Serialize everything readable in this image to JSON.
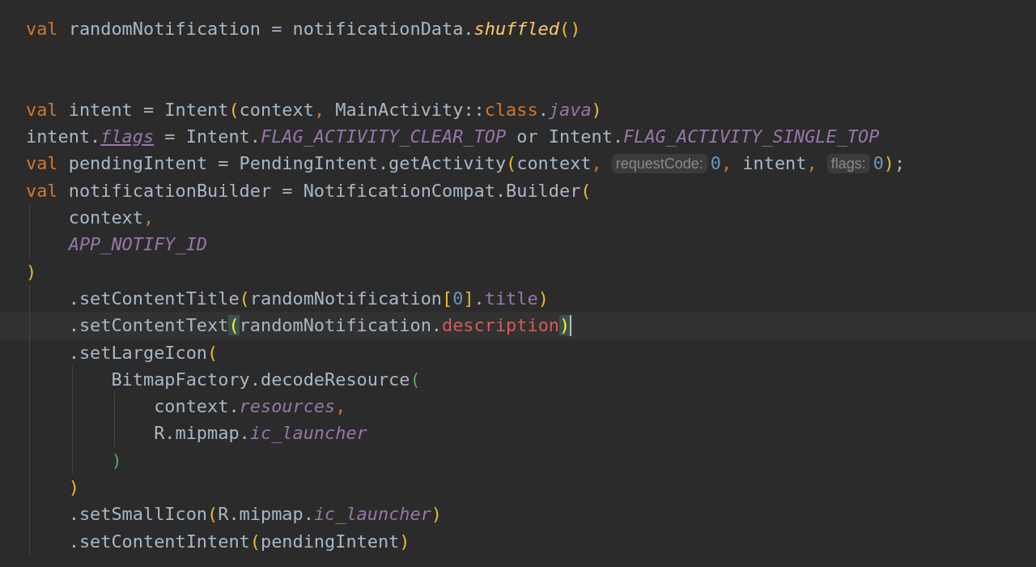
{
  "editor": {
    "lines": [
      {
        "current": false,
        "tokens": [
          {
            "kind": "kw",
            "text": "val"
          },
          {
            "kind": "plain",
            "text": " randomNotification = notificationData."
          },
          {
            "kind": "fn",
            "text": "shuffled"
          },
          {
            "kind": "paren",
            "text": "()"
          }
        ]
      },
      {
        "current": false
      },
      {
        "current": false
      },
      {
        "current": false,
        "tokens": [
          {
            "kind": "kw",
            "text": "val"
          },
          {
            "kind": "plain",
            "text": " intent = Intent"
          },
          {
            "kind": "paren",
            "text": "("
          },
          {
            "kind": "plain",
            "text": "context"
          },
          {
            "kind": "punct",
            "text": ","
          },
          {
            "kind": "plain",
            "text": " MainActivity::"
          },
          {
            "kind": "kw",
            "text": "class"
          },
          {
            "kind": "plain",
            "text": "."
          },
          {
            "kind": "ital",
            "text": "java"
          },
          {
            "kind": "paren",
            "text": ")"
          }
        ]
      },
      {
        "current": false,
        "tokens": [
          {
            "kind": "plain",
            "text": "intent."
          },
          {
            "kind": "underlined",
            "text": "flags"
          },
          {
            "kind": "plain",
            "text": " = Intent."
          },
          {
            "kind": "ital",
            "text": "FLAG_ACTIVITY_CLEAR_TOP"
          },
          {
            "kind": "plain",
            "text": " or Intent."
          },
          {
            "kind": "ital",
            "text": "FLAG_ACTIVITY_SINGLE_TOP"
          }
        ]
      },
      {
        "current": false,
        "tokens": [
          {
            "kind": "kw",
            "text": "val"
          },
          {
            "kind": "plain",
            "text": " pendingIntent = PendingIntent.getActivity"
          },
          {
            "kind": "paren",
            "text": "("
          },
          {
            "kind": "plain",
            "text": "context"
          },
          {
            "kind": "punct",
            "text": ","
          },
          {
            "kind": "hint",
            "text": "requestCode:"
          },
          {
            "kind": "num",
            "text": "0"
          },
          {
            "kind": "punct",
            "text": ","
          },
          {
            "kind": "plain",
            "text": " intent"
          },
          {
            "kind": "punct",
            "text": ","
          },
          {
            "kind": "hint",
            "text": "flags:"
          },
          {
            "kind": "num",
            "text": "0"
          },
          {
            "kind": "paren",
            "text": ")"
          },
          {
            "kind": "plain",
            "text": ";"
          }
        ]
      },
      {
        "current": false,
        "tokens": [
          {
            "kind": "kw",
            "text": "val"
          },
          {
            "kind": "plain",
            "text": " notificationBuilder = NotificationCompat.Builder"
          },
          {
            "kind": "paren",
            "text": "("
          }
        ]
      },
      {
        "current": false,
        "tokens": [
          {
            "kind": "plain",
            "text": "    context"
          },
          {
            "kind": "punct",
            "text": ","
          }
        ]
      },
      {
        "current": false,
        "tokens": [
          {
            "kind": "ital",
            "text": "    APP_NOTIFY_ID"
          }
        ]
      },
      {
        "current": false,
        "tokens": [
          {
            "kind": "paren",
            "text": ")"
          }
        ]
      },
      {
        "current": false,
        "tokens": [
          {
            "kind": "plain",
            "text": "    .setContentTitle"
          },
          {
            "kind": "paren",
            "text": "("
          },
          {
            "kind": "plain",
            "text": "randomNotification"
          },
          {
            "kind": "paren",
            "text": "["
          },
          {
            "kind": "num",
            "text": "0"
          },
          {
            "kind": "paren",
            "text": "]"
          },
          {
            "kind": "plain",
            "text": "."
          },
          {
            "kind": "prop",
            "text": "title"
          },
          {
            "kind": "paren",
            "text": ")"
          }
        ]
      },
      {
        "current": true,
        "tokens": [
          {
            "kind": "plain",
            "text": "    .setContentText"
          },
          {
            "kind": "match",
            "text": "("
          },
          {
            "kind": "plain",
            "text": "randomNotification."
          },
          {
            "kind": "error",
            "text": "description"
          },
          {
            "kind": "match",
            "text": ")"
          }
        ]
      },
      {
        "current": false,
        "tokens": [
          {
            "kind": "plain",
            "text": "    .setLargeIcon"
          },
          {
            "kind": "paren",
            "text": "("
          }
        ]
      },
      {
        "current": false,
        "tokens": [
          {
            "kind": "plain",
            "text": "        BitmapFactory.decodeResource"
          },
          {
            "kind": "paren2",
            "text": "("
          }
        ]
      },
      {
        "current": false,
        "tokens": [
          {
            "kind": "plain",
            "text": "            context."
          },
          {
            "kind": "ital",
            "text": "resources"
          },
          {
            "kind": "punct",
            "text": ","
          }
        ]
      },
      {
        "current": false,
        "tokens": [
          {
            "kind": "plain",
            "text": "            R.mipmap."
          },
          {
            "kind": "ital",
            "text": "ic_launcher"
          }
        ]
      },
      {
        "current": false,
        "tokens": [
          {
            "kind": "paren2",
            "text": "        )"
          }
        ]
      },
      {
        "current": false,
        "tokens": [
          {
            "kind": "paren",
            "text": "    )"
          }
        ]
      },
      {
        "current": false,
        "tokens": [
          {
            "kind": "plain",
            "text": "    .setSmallIcon"
          },
          {
            "kind": "paren",
            "text": "("
          },
          {
            "kind": "plain",
            "text": "R.mipmap."
          },
          {
            "kind": "ital",
            "text": "ic_launcher"
          },
          {
            "kind": "paren",
            "text": ")"
          }
        ]
      },
      {
        "current": false,
        "tokens": [
          {
            "kind": "plain",
            "text": "    .setContentIntent"
          },
          {
            "kind": "paren",
            "text": "("
          },
          {
            "kind": "plain",
            "text": "pendingIntent"
          },
          {
            "kind": "paren",
            "text": ")"
          }
        ]
      }
    ]
  }
}
